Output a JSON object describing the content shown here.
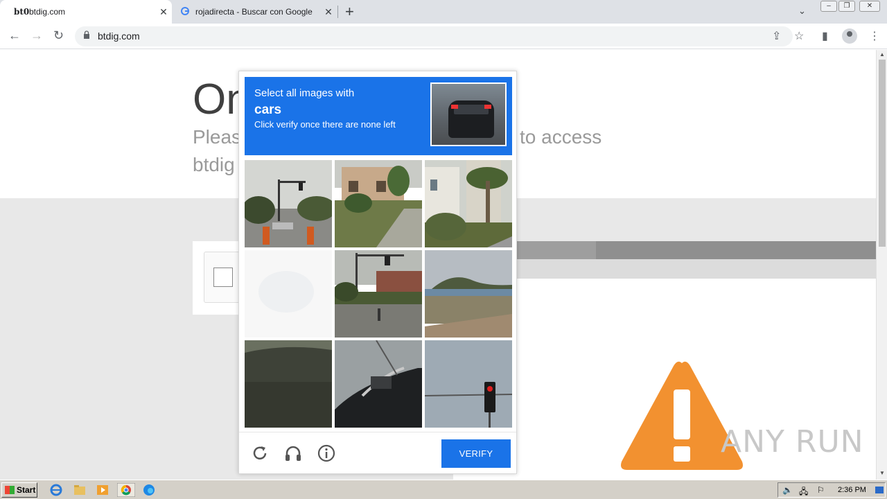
{
  "browser": {
    "tabs": [
      {
        "title": "btdig.com",
        "favicon": "bt0",
        "active": true
      },
      {
        "title": "rojadirecta - Buscar con Google",
        "favicon": "google-icon",
        "active": false
      }
    ],
    "url": "btdig.com"
  },
  "page": {
    "heading": "On",
    "subtext_left": "Pleas",
    "subtext_right": "to access",
    "subtext_line2": "btdig"
  },
  "captcha": {
    "instruction_line1": "Select all images with",
    "target_word": "cars",
    "instruction_line3": "Click verify once there are none left",
    "verify_label": "VERIFY",
    "tiles": [
      {
        "description": "traffic-lights-roadworks"
      },
      {
        "description": "house-with-garden"
      },
      {
        "description": "palm-tree-building"
      },
      {
        "description": "faded-white-tile"
      },
      {
        "description": "street-corner-traffic-light"
      },
      {
        "description": "coastal-hill"
      },
      {
        "description": "dark-overpass"
      },
      {
        "description": "boat-hull"
      },
      {
        "description": "red-traffic-light"
      }
    ]
  },
  "watermark": "ANY RUN",
  "taskbar": {
    "start_label": "Start",
    "clock": "2:36 PM"
  },
  "colors": {
    "accent": "#1a73e8",
    "warning": "#f29130"
  }
}
